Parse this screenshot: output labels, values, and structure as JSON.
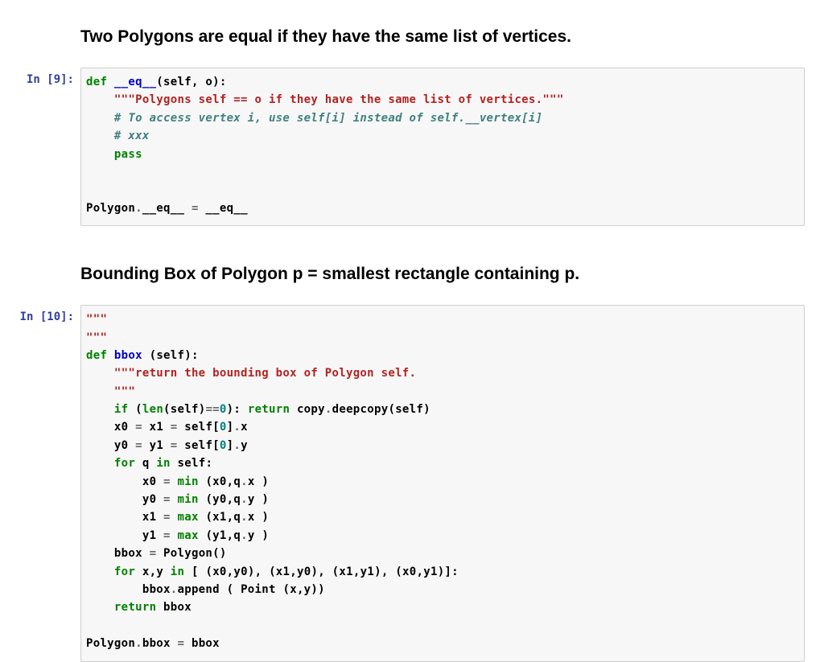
{
  "cells": {
    "md1": {
      "heading": "Two Polygons are equal if they have the same list of vertices."
    },
    "c9": {
      "prompt": "In [9]:",
      "lines": {
        "0": {
          "kw": "def",
          "sp": " ",
          "fn": "__eq__",
          "p0": "(",
          "a0": "self",
          "c": ",",
          "sp2": " ",
          "a1": "o",
          "p1": ")",
          "col": ":"
        },
        "1": {
          "str": "\"\"\"Polygons self == o if they have the same list of vertices.\"\"\""
        },
        "2": {
          "cmt": "# To access vertex i, use self[i] instead of self.__vertex[i]"
        },
        "3": {
          "cmt": "# xxx"
        },
        "4": {
          "kw": "pass"
        },
        "5": {
          "n0": "Polygon",
          "dot": ".",
          "n1": "__eq__",
          "sp": " ",
          "eq": "=",
          "sp2": " ",
          "n2": "__eq__"
        }
      }
    },
    "md2": {
      "heading": "Bounding Box of Polygon p = smallest rectangle containing p."
    },
    "c10": {
      "prompt": "In [10]:",
      "lines": {
        "0": {
          "str": "\"\"\""
        },
        "1": {
          "str": "\"\"\""
        },
        "2": {
          "kw": "def",
          "sp": " ",
          "fn": "bbox",
          "sp2": " ",
          "p0": "(",
          "a0": "self",
          "p1": ")",
          "col": ":"
        },
        "3": {
          "str": "\"\"\"return the bounding box of Polygon self."
        },
        "4": {
          "str": "\"\"\""
        },
        "5": {
          "kw1": "if",
          "sp": " ",
          "p0": "(",
          "f": "len",
          "p1": "(",
          "s": "self",
          "p2": ")",
          "eq": "==",
          "n": "0",
          "p3": ")",
          "col": ":",
          "sp2": " ",
          "kw2": "return",
          "sp3": " ",
          "c": "copy",
          "dot": ".",
          "d": "deepcopy",
          "p4": "(",
          "s2": "self",
          "p5": ")"
        },
        "6": {
          "x0": "x0",
          "sp": " ",
          "eq1": "=",
          "sp2": " ",
          "x1": "x1",
          "sp3": " ",
          "eq2": "=",
          "sp4": " ",
          "s": "self",
          "b0": "[",
          "n": "0",
          "b1": "]",
          "dot": ".",
          "xattr": "x"
        },
        "7": {
          "y0": "y0",
          "sp": " ",
          "eq1": "=",
          "sp2": " ",
          "y1": "y1",
          "sp3": " ",
          "eq2": "=",
          "sp4": " ",
          "s": "self",
          "b0": "[",
          "n": "0",
          "b1": "]",
          "dot": ".",
          "yattr": "y"
        },
        "8": {
          "kw1": "for",
          "sp": " ",
          "q": "q",
          "sp2": " ",
          "kw2": "in",
          "sp3": " ",
          "s": "self",
          "col": ":"
        },
        "9": {
          "v": "x0",
          "sp": " ",
          "eq": "=",
          "sp2": " ",
          "f": "min",
          "sp3": " ",
          "p0": "(",
          "a0": "x0",
          "c": ",",
          "a1": "q",
          "dot": ".",
          "xattr": "x",
          "sp4": " ",
          "p1": ")"
        },
        "10": {
          "v": "y0",
          "sp": " ",
          "eq": "=",
          "sp2": " ",
          "f": "min",
          "sp3": " ",
          "p0": "(",
          "a0": "y0",
          "c": ",",
          "a1": "q",
          "dot": ".",
          "yattr": "y",
          "sp4": " ",
          "p1": ")"
        },
        "11": {
          "v": "x1",
          "sp": " ",
          "eq": "=",
          "sp2": " ",
          "f": "max",
          "sp3": " ",
          "p0": "(",
          "a0": "x1",
          "c": ",",
          "a1": "q",
          "dot": ".",
          "xattr": "x",
          "sp4": " ",
          "p1": ")"
        },
        "12": {
          "v": "y1",
          "sp": " ",
          "eq": "=",
          "sp2": " ",
          "f": "max",
          "sp3": " ",
          "p0": "(",
          "a0": "y1",
          "c": ",",
          "a1": "q",
          "dot": ".",
          "yattr": "y",
          "sp4": " ",
          "p1": ")"
        },
        "13": {
          "b": "bbox",
          "sp": " ",
          "eq": "=",
          "sp2": " ",
          "P": "Polygon",
          "p0": "(",
          "p1": ")"
        },
        "14": {
          "kw1": "for",
          "sp": " ",
          "x": "x",
          "c": ",",
          "y": "y",
          "sp2": " ",
          "kw2": "in",
          "sp3": " ",
          "b0": "[",
          "sp4": " ",
          "pt0o": "(",
          "pt0a": "x0",
          "pt0c": ",",
          "pt0b": "y0",
          "pt0p": ")",
          "c1": ",",
          "sp5": " ",
          "pt1o": "(",
          "pt1a": "x1",
          "pt1c": ",",
          "pt1b": "y0",
          "pt1p": ")",
          "c2": ",",
          "sp6": " ",
          "pt2o": "(",
          "pt2a": "x1",
          "pt2c": ",",
          "pt2b": "y1",
          "pt2p": ")",
          "c3": ",",
          "sp7": " ",
          "pt3o": "(",
          "pt3a": "x0",
          "pt3c": ",",
          "pt3b": "y1",
          "pt3p": ")",
          "b1": "]",
          "col": ":"
        },
        "15": {
          "b": "bbox",
          "dot": ".",
          "ap": "append",
          "sp": " ",
          "p0": "(",
          "sp2": " ",
          "P": "Point",
          "sp3": " ",
          "pp0": "(",
          "x": "x",
          "c": ",",
          "y": "y",
          "pp1": ")",
          "p1": ")"
        },
        "16": {
          "kw": "return",
          "sp": " ",
          "b": "bbox"
        },
        "17": {
          "P": "Polygon",
          "dot": ".",
          "b": "bbox",
          "sp": " ",
          "eq": "=",
          "sp2": " ",
          "b2": "bbox"
        }
      }
    }
  }
}
